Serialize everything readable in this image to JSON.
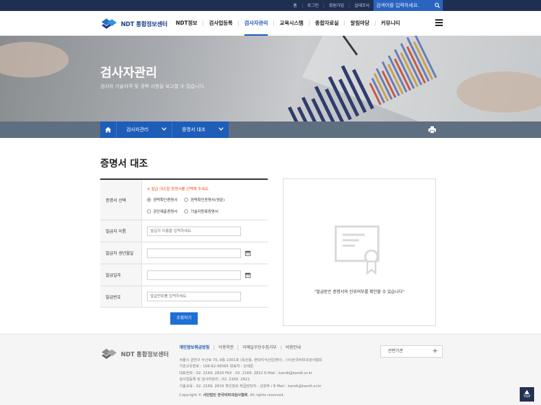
{
  "utility": {
    "links": [
      "홈",
      "로그인",
      "회원가입",
      "실태조사"
    ],
    "search_placeholder": "검색어를 입력하세요."
  },
  "header": {
    "logo_text": "NDT 통합정보센터",
    "nav": [
      "NDT정보",
      "검사업등록",
      "검사자관리",
      "교육시스템",
      "종합자료실",
      "알림마당",
      "커뮤니티"
    ],
    "active_nav": "검사자관리"
  },
  "visual": {
    "title": "검사자관리",
    "subtitle": "검사자 기술자격 및 경력 사항을 보고할 수 있습니다."
  },
  "subnav": {
    "crumb1": "검사자관리",
    "crumb2": "증명서 대조"
  },
  "page": {
    "title": "증명서 대조"
  },
  "form": {
    "cert_label": "증명서 선택",
    "notice": "※ 발급 대조할 증명서를 선택해 주세요.",
    "options": [
      "경력확인증명서",
      "경력확인증명서(영문)",
      "공단제출증명서",
      "기술자등록증명서"
    ],
    "selected_option": "경력확인증명서",
    "name_label": "발급자 이름",
    "name_placeholder": "발급자 이름을 입력하세요.",
    "birth_label": "발급자 생년월일",
    "date_label": "발급일자",
    "number_label": "발급번호",
    "number_placeholder": "발급번호를 입력하세요.",
    "submit": "조회하기"
  },
  "result": {
    "message": "\"발급받은 증명서의 진위여부를 확인할 수 있습니다\""
  },
  "footer": {
    "logo_text": "NDT 통합정보센터",
    "links": [
      "개인정보취급방침",
      "이용약관",
      "이메일무단수집거부",
      "비용안내"
    ],
    "info_lines": [
      "서울시 금천구 두산로 70, 8동 2301호 (독산동, 현대지식산업센터) , (사)한국비파괴검사협회",
      "기관고유번호 : 108-82-06565    대표자 : 손태준",
      "대표전화 : 02. 2169. 2820    FAX : 02. 2169. 2822    E-Mail : kandt@kandt.or.kr",
      "검사업등록 및 검사자관리 : 02. 2169. 2821",
      "기술교육 : 02. 2169. 2819    개인정보 취급담당자 : 김양주 / E-Mail : kandt@kandt.or.kr"
    ],
    "copyright_prefix": "Copyright ©",
    "copyright_org": "사단법인 한국비파괴검사협회",
    "copyright_suffix": ". All rights reserved.",
    "related_label": "관련기관",
    "top_label": "TOP"
  },
  "colors": {
    "brand_blue": "#1e5db8",
    "top_bar": "#1f2f52",
    "notice_red": "#e8542c"
  }
}
